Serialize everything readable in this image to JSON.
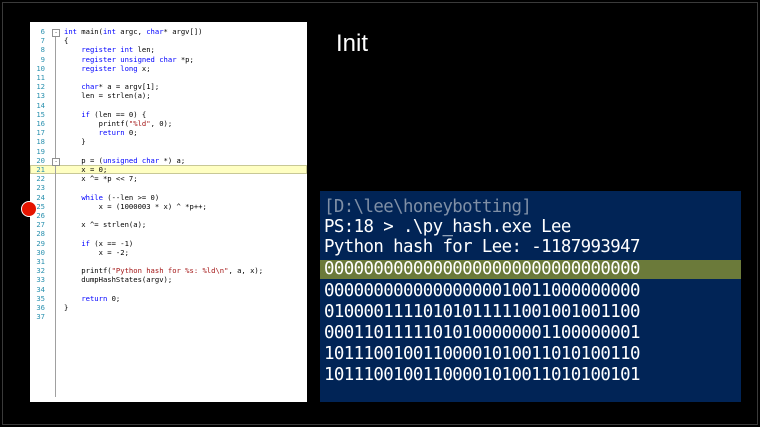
{
  "slide": {
    "title": "Init"
  },
  "editor": {
    "lines": [
      {
        "n": "6",
        "t": "int main(int argc, char* argv[])"
      },
      {
        "n": "7",
        "t": "{"
      },
      {
        "n": "8",
        "t": "    register int len;"
      },
      {
        "n": "9",
        "t": "    register unsigned char *p;"
      },
      {
        "n": "10",
        "t": "    register long x;"
      },
      {
        "n": "11",
        "t": ""
      },
      {
        "n": "12",
        "t": "    char* a = argv[1];"
      },
      {
        "n": "13",
        "t": "    len = strlen(a);"
      },
      {
        "n": "14",
        "t": ""
      },
      {
        "n": "15",
        "t": "    if (len == 0) {"
      },
      {
        "n": "16",
        "t": "        printf(\"%ld\", 0);"
      },
      {
        "n": "17",
        "t": "        return 0;"
      },
      {
        "n": "18",
        "t": "    }"
      },
      {
        "n": "19",
        "t": ""
      },
      {
        "n": "20",
        "t": "    p = (unsigned char *) a;"
      },
      {
        "n": "21",
        "t": "    x = 0;"
      },
      {
        "n": "22",
        "t": "    x ^= *p << 7;"
      },
      {
        "n": "23",
        "t": ""
      },
      {
        "n": "24",
        "t": "    while (--len >= 0)"
      },
      {
        "n": "25",
        "t": "        x = (1000003 * x) ^ *p++;"
      },
      {
        "n": "26",
        "t": ""
      },
      {
        "n": "27",
        "t": "    x ^= strlen(a);"
      },
      {
        "n": "28",
        "t": ""
      },
      {
        "n": "29",
        "t": "    if (x == -1)"
      },
      {
        "n": "30",
        "t": "        x = -2;"
      },
      {
        "n": "31",
        "t": ""
      },
      {
        "n": "32",
        "t": "    printf(\"Python hash for %s: %ld\\n\", a, x);"
      },
      {
        "n": "33",
        "t": "    dumpHashStates(argv);"
      },
      {
        "n": "34",
        "t": ""
      },
      {
        "n": "35",
        "t": "    return 0;"
      },
      {
        "n": "36",
        "t": "}"
      },
      {
        "n": "37",
        "t": ""
      }
    ],
    "current_line_index": 15,
    "breakpoint_line": "21"
  },
  "terminal": {
    "path_line": "[D:\\lee\\honeybotting]",
    "prompt_line": "PS:18 > .\\py_hash.exe Lee",
    "output_line": "Python hash for Lee: -1187993947",
    "highlighted_line": "00000000000000000000000000000000",
    "binary_lines": [
      "00000000000000000010011000000000",
      "01000011110101011111001001001100",
      "00011011111010100000001100000001",
      "10111001001100001010011010100110",
      "10111001001100001010011010100101"
    ],
    "colors": {
      "background": "#012456",
      "highlight": "#6b7a3a",
      "text": "#ffffff"
    }
  }
}
